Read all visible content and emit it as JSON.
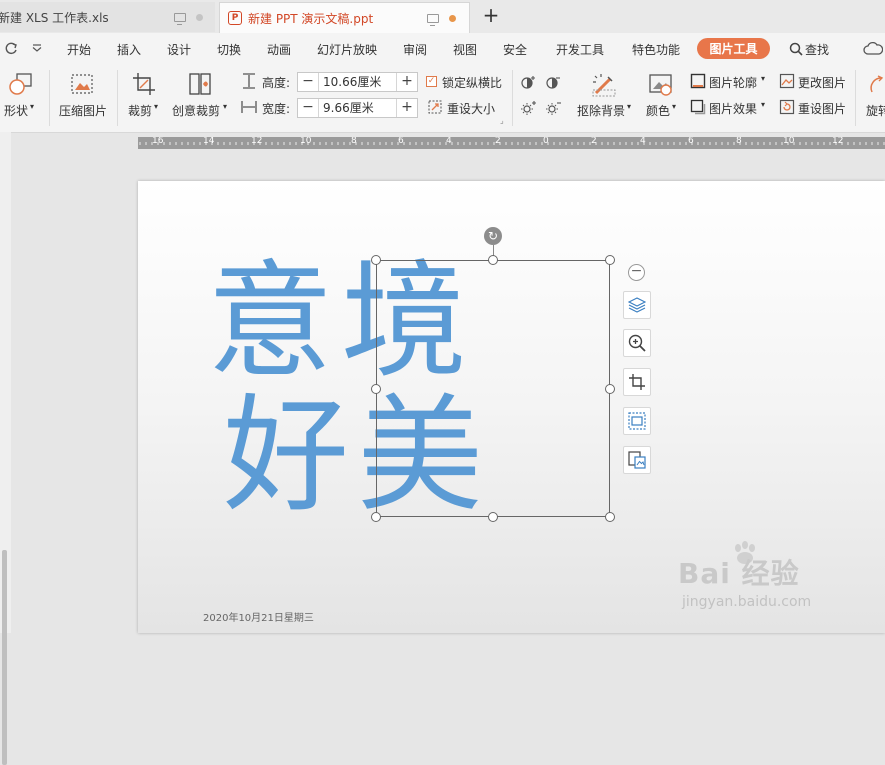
{
  "tabs": [
    {
      "title": "新建 XLS 工作表.xls"
    },
    {
      "title": "新建 PPT 演示文稿.ppt"
    }
  ],
  "new_tab": "+",
  "menu": {
    "items": [
      "开始",
      "插入",
      "设计",
      "切换",
      "动画",
      "幻灯片放映",
      "审阅",
      "视图",
      "安全",
      "开发工具",
      "特色功能"
    ],
    "active": "图片工具",
    "search": "查找"
  },
  "ribbon": {
    "shape": "形状",
    "compress": "压缩图片",
    "crop": "裁剪",
    "creative_crop": "创意裁剪",
    "height_label": "高度:",
    "height_value": "10.66厘米",
    "width_label": "宽度:",
    "width_value": "9.66厘米",
    "lock_ratio": "锁定纵横比",
    "reset_size": "重设大小",
    "remove_bg": "抠除背景",
    "color": "颜色",
    "pic_outline": "图片轮廓",
    "pic_effect": "图片效果",
    "change_pic": "更改图片",
    "reset_pic": "重设图片",
    "rotate": "旋转"
  },
  "ruler": {
    "labels": [
      "16",
      "14",
      "12",
      "10",
      "8",
      "6",
      "4",
      "2",
      "0",
      "2",
      "4",
      "6",
      "8",
      "10",
      "12"
    ]
  },
  "slide": {
    "picture_chars": [
      "意",
      "境",
      "好",
      "美"
    ],
    "date": "2020年10月21日星期三"
  },
  "watermark": {
    "main": "Bai 经验",
    "url": "jingyan.baidu.com"
  },
  "colors": {
    "accent": "#e8764a",
    "picture_text": "#5b9bd5",
    "ppt_brand": "#d24726"
  }
}
